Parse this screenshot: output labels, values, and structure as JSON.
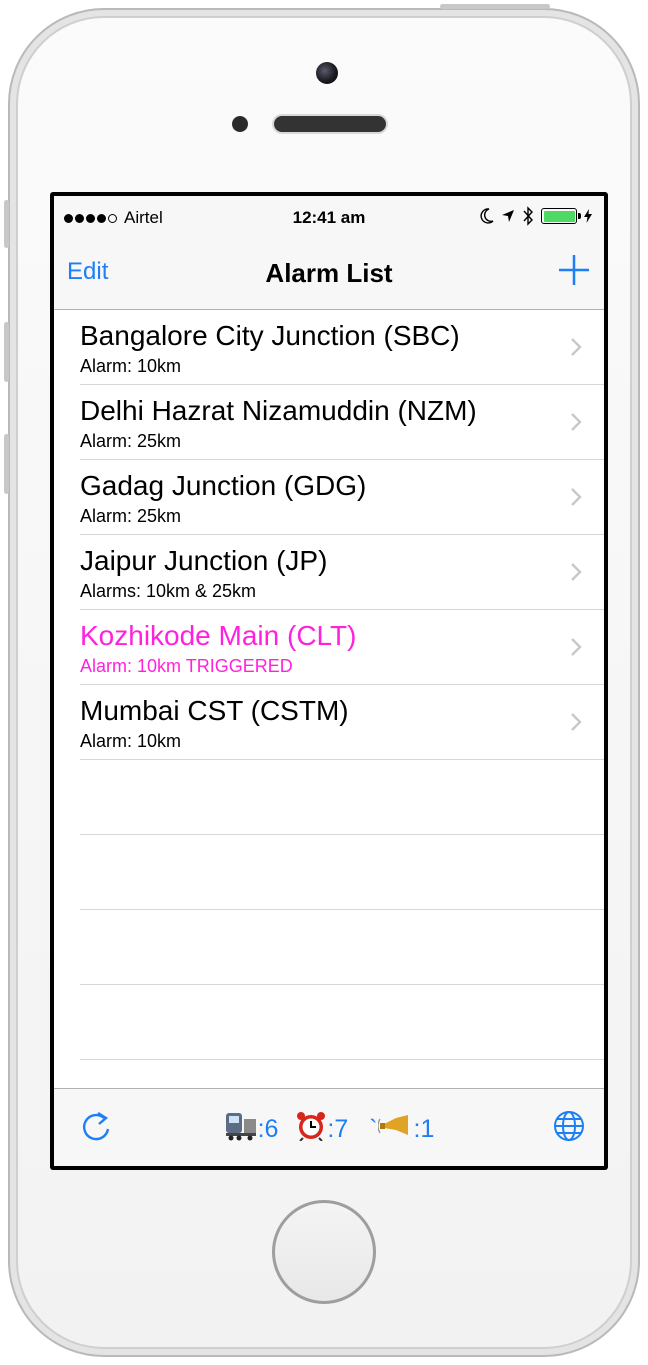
{
  "status_bar": {
    "signal_dots_filled": 4,
    "signal_dots_total": 5,
    "carrier": "Airtel",
    "time": "12:41 am",
    "icons": [
      "moon-icon",
      "location-arrow-icon",
      "bluetooth-icon",
      "battery-icon",
      "charging-bolt-icon"
    ],
    "battery_level": 1.0,
    "battery_color": "#4cd964"
  },
  "nav": {
    "edit_label": "Edit",
    "title": "Alarm List",
    "add_icon": "plus-icon"
  },
  "alarms": [
    {
      "title": "Bangalore City Junction (SBC)",
      "subtitle": "Alarm: 10km",
      "triggered": false
    },
    {
      "title": "Delhi Hazrat Nizamuddin (NZM)",
      "subtitle": "Alarm: 25km",
      "triggered": false
    },
    {
      "title": "Gadag Junction (GDG)",
      "subtitle": "Alarm: 25km",
      "triggered": false
    },
    {
      "title": "Jaipur Junction (JP)",
      "subtitle": "Alarms: 10km & 25km",
      "triggered": false
    },
    {
      "title": "Kozhikode Main (CLT)",
      "subtitle": "Alarm: 10km TRIGGERED",
      "triggered": true
    },
    {
      "title": "Mumbai CST (CSTM)",
      "subtitle": "Alarm: 10km",
      "triggered": false
    }
  ],
  "toolbar": {
    "refresh_icon": "refresh-icon",
    "stats": [
      {
        "icon": "train-icon",
        "value": ":6"
      },
      {
        "icon": "alarm-clock-icon",
        "value": ":7"
      },
      {
        "icon": "horn-icon",
        "prefix": "`",
        "value": ":1"
      }
    ],
    "globe_icon": "globe-icon"
  },
  "colors": {
    "accent": "#1e7ff5",
    "triggered": "#ff22dd"
  }
}
